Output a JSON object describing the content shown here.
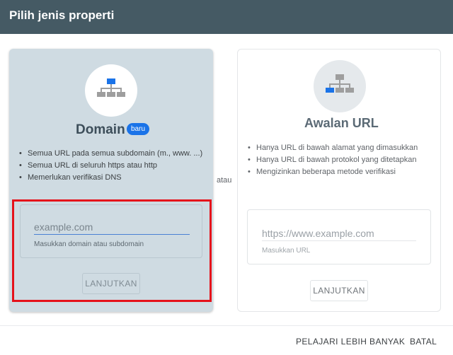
{
  "header": {
    "title": "Pilih jenis properti"
  },
  "domain_card": {
    "title": "Domain",
    "badge": "baru",
    "features": [
      "Semua URL pada semua subdomain (m., www. ...)",
      "Semua URL di seluruh https atau http",
      "Memerlukan verifikasi DNS"
    ],
    "input_placeholder": "example.com",
    "input_value": "",
    "helper": "Masukkan domain atau subdomain",
    "button": "LANJUTKAN"
  },
  "separator": "atau",
  "url_prefix_card": {
    "title": "Awalan URL",
    "features": [
      "Hanya URL di bawah alamat yang dimasukkan",
      "Hanya URL di bawah protokol yang ditetapkan",
      "Mengizinkan beberapa metode verifikasi"
    ],
    "input_placeholder": "https://www.example.com",
    "input_value": "",
    "helper": "Masukkan URL",
    "button": "LANJUTKAN"
  },
  "footer": {
    "learn_more": "PELAJARI LEBIH BANYAK",
    "cancel": "BATAL"
  },
  "colors": {
    "header_bg": "#455a64",
    "selected_card_bg": "#cfdbe2",
    "accent": "#1a73e8",
    "highlight_border": "#e5121b"
  }
}
